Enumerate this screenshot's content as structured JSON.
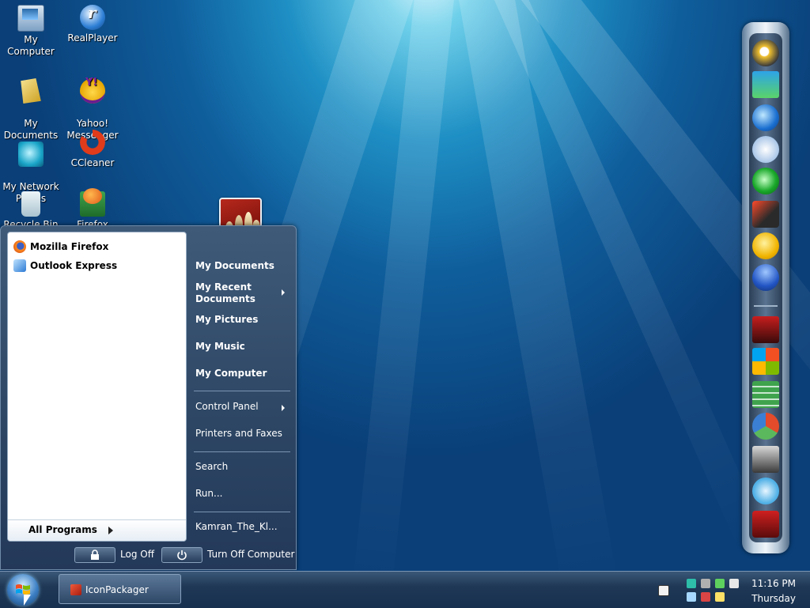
{
  "desktop": {
    "icons": [
      {
        "label": "My Computer",
        "icon": "computer-icon"
      },
      {
        "label": "RealPlayer",
        "icon": "realplayer-icon"
      },
      {
        "label": "My\nDocuments",
        "icon": "documents-folder-icon"
      },
      {
        "label": "Yahoo!\nMessenger",
        "icon": "yahoo-messenger-icon"
      },
      {
        "label": "My Network\nPlaces",
        "icon": "network-places-icon"
      },
      {
        "label": "CCleaner",
        "icon": "ccleaner-icon"
      },
      {
        "label": "Recycle Bin",
        "icon": "recycle-bin-icon"
      },
      {
        "label": "Firefox Setup",
        "icon": "firefox-setup-icon"
      }
    ]
  },
  "start_menu": {
    "pinned": [
      {
        "label": "Mozilla Firefox",
        "icon": "firefox-icon"
      },
      {
        "label": "Outlook Express",
        "icon": "outlook-express-icon"
      }
    ],
    "all_programs": "All Programs",
    "right_items": {
      "my_documents": "My Documents",
      "my_recent_documents_line1": "My Recent",
      "my_recent_documents_line2": "Documents",
      "my_pictures": "My Pictures",
      "my_music": "My Music",
      "my_computer": "My Computer",
      "control_panel": "Control Panel",
      "printers_and_faxes": "Printers and Faxes",
      "search": "Search",
      "run": "Run...",
      "user": "Kamran_The_Kl..."
    },
    "log_off": "Log Off",
    "turn_off": "Turn Off Computer",
    "user_picture": "chess-pieces-avatar"
  },
  "taskbar": {
    "start_orb": "windows-orb",
    "task_button": "IconPackager",
    "clock_time": "11:16 PM",
    "clock_day": "Thursday"
  },
  "colors": {
    "desktop_accent": "#1e8fc4",
    "start_menu_bg": "#2c4563",
    "taskbar_bg": "#1f3856"
  }
}
